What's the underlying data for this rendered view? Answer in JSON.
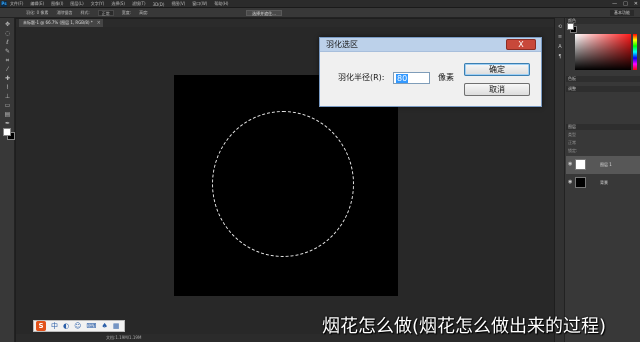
{
  "app": {
    "logo": "Ps"
  },
  "menubar": {
    "items": [
      "文件(F)",
      "编辑(E)",
      "图像(I)",
      "图层(L)",
      "文字(Y)",
      "选择(S)",
      "滤镜(T)",
      "3D(D)",
      "视图(V)",
      "窗口(W)",
      "帮助(H)"
    ],
    "controls": [
      "—",
      "□",
      "✕"
    ]
  },
  "options": {
    "feather_label": "羽化: 0 像素",
    "antialias": "消除锯齿",
    "style_label": "样式:",
    "style_value": "正常",
    "width_label": "宽度:",
    "height_label": "高度:",
    "mask_button": "选择并遮住...",
    "workspace": "基本功能"
  },
  "document": {
    "tab_title": "未标题-1 @ 66.7% (图层 1, RGB/8) *",
    "close": "×",
    "status": "文档:1.19M/1.19M"
  },
  "dialog": {
    "title": "羽化选区",
    "close": "X",
    "field_label": "羽化半径(R):",
    "radius_value": "80",
    "unit": "像素",
    "ok_label": "确定",
    "cancel_label": "取消"
  },
  "panels": {
    "color_tab": "颜色",
    "swatches_tab": "色板",
    "adjust_tab": "调整",
    "layers_tab": "图层",
    "kind_label": "类型",
    "blend_mode": "正常",
    "lock_label": "锁定:",
    "layers": [
      {
        "name": "图层 1",
        "thumb": "#ffffff",
        "selected": true
      },
      {
        "name": "背景",
        "thumb": "#000000",
        "selected": false
      }
    ]
  },
  "ime": {
    "logo": "S"
  },
  "caption": "烟花怎么做(烟花怎么做出来的过程)",
  "colors": {
    "foreground": "#ffffff",
    "background": "#000000",
    "canvas": "#000000",
    "workspace": "#282828"
  }
}
